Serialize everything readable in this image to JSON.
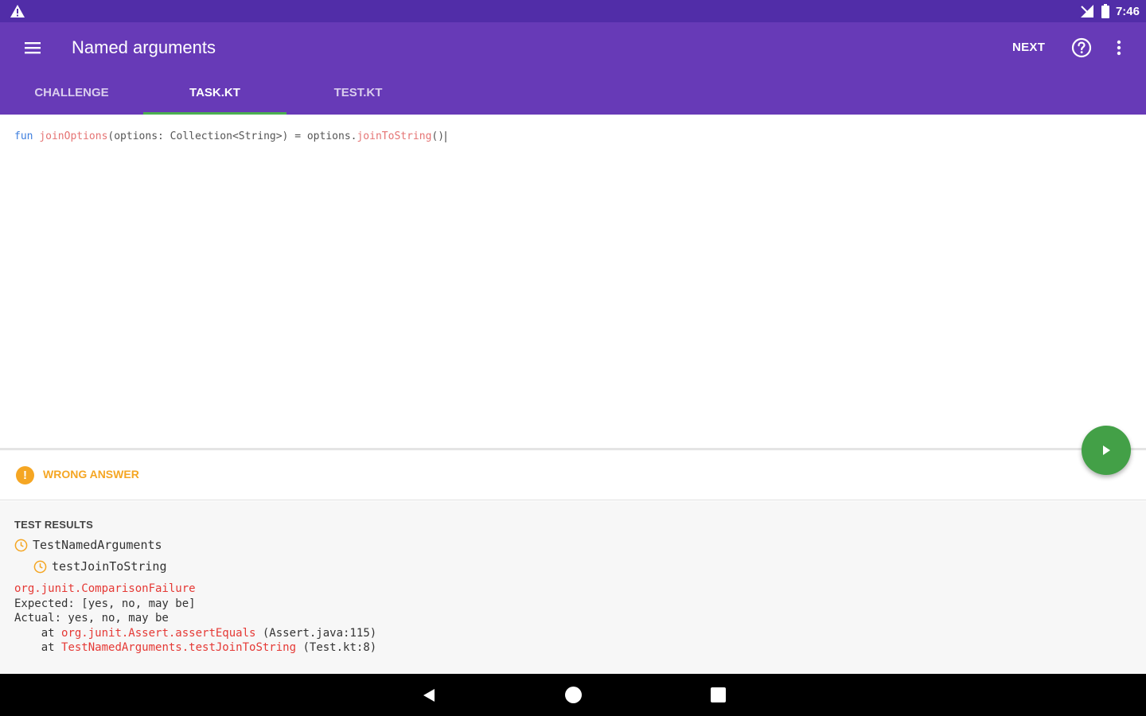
{
  "status_bar": {
    "time": "7:46"
  },
  "app_bar": {
    "title": "Named arguments",
    "next_label": "NEXT",
    "tabs": [
      {
        "label": "CHALLENGE",
        "active": false
      },
      {
        "label": "TASK.KT",
        "active": true
      },
      {
        "label": "TEST.KT",
        "active": false
      }
    ]
  },
  "editor": {
    "keyword": "fun",
    "function_name": "joinOptions",
    "signature_rest": "(options: Collection<String>) = options.",
    "call_name": "joinToString",
    "call_args": "()"
  },
  "result": {
    "status_label": "WRONG ANSWER",
    "status_icon": "!",
    "accent_color": "#f5a623"
  },
  "test_results": {
    "title": "TEST RESULTS",
    "suite": "TestNamedArguments",
    "case": "testJoinToString",
    "exception": "org.junit.ComparisonFailure",
    "expected": "Expected: [yes, no, may be]",
    "actual": "Actual: yes, no, may be",
    "at_prefix": "    at ",
    "frame1_method": "org.junit.Assert.assertEquals",
    "frame1_loc": " (Assert.java:115)",
    "frame2_method": "TestNamedArguments.testJoinToString",
    "frame2_loc": " (Test.kt:8)"
  },
  "colors": {
    "status_bar": "#512da8",
    "app_bar": "#673ab7",
    "tab_indicator": "#4caf50",
    "fab": "#43a047",
    "error_text": "#e53935"
  },
  "icons": [
    "warning-icon",
    "signal-icon",
    "battery-icon",
    "menu-icon",
    "help-icon",
    "more-vert-icon",
    "play-icon",
    "clock-icon",
    "back-icon",
    "home-icon",
    "recents-icon"
  ]
}
